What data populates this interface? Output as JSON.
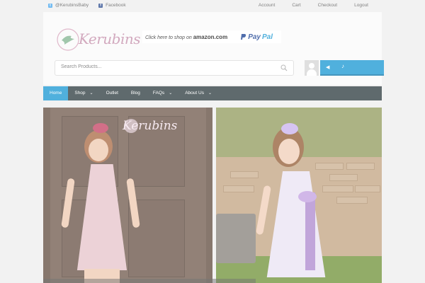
{
  "topbar": {
    "twitter": "@KerubinsBaby",
    "facebook": "Facebook",
    "links": [
      "Account",
      "Cart",
      "Checkout",
      "Logout"
    ]
  },
  "header": {
    "logo_text": "Kerubins",
    "ad_amazon_text": "Click here to shop on",
    "ad_amazon_brand": "amazon.com",
    "ad_paypal_a": "Pay",
    "ad_paypal_b": "Pal"
  },
  "search": {
    "placeholder": "Search Products..."
  },
  "nav": {
    "items": [
      {
        "label": "Home",
        "active": true
      },
      {
        "label": "Shop",
        "caret": true
      },
      {
        "label": "Outlet"
      },
      {
        "label": "Blog"
      },
      {
        "label": "FAQs",
        "caret": true
      },
      {
        "label": "About Us",
        "caret": true
      }
    ]
  },
  "hero": {
    "left_logo_text": "Kerubins"
  },
  "colors": {
    "accent": "#2a9fd6",
    "nav_bg": "#3c4a4d",
    "brand_pink": "#c996b0"
  }
}
